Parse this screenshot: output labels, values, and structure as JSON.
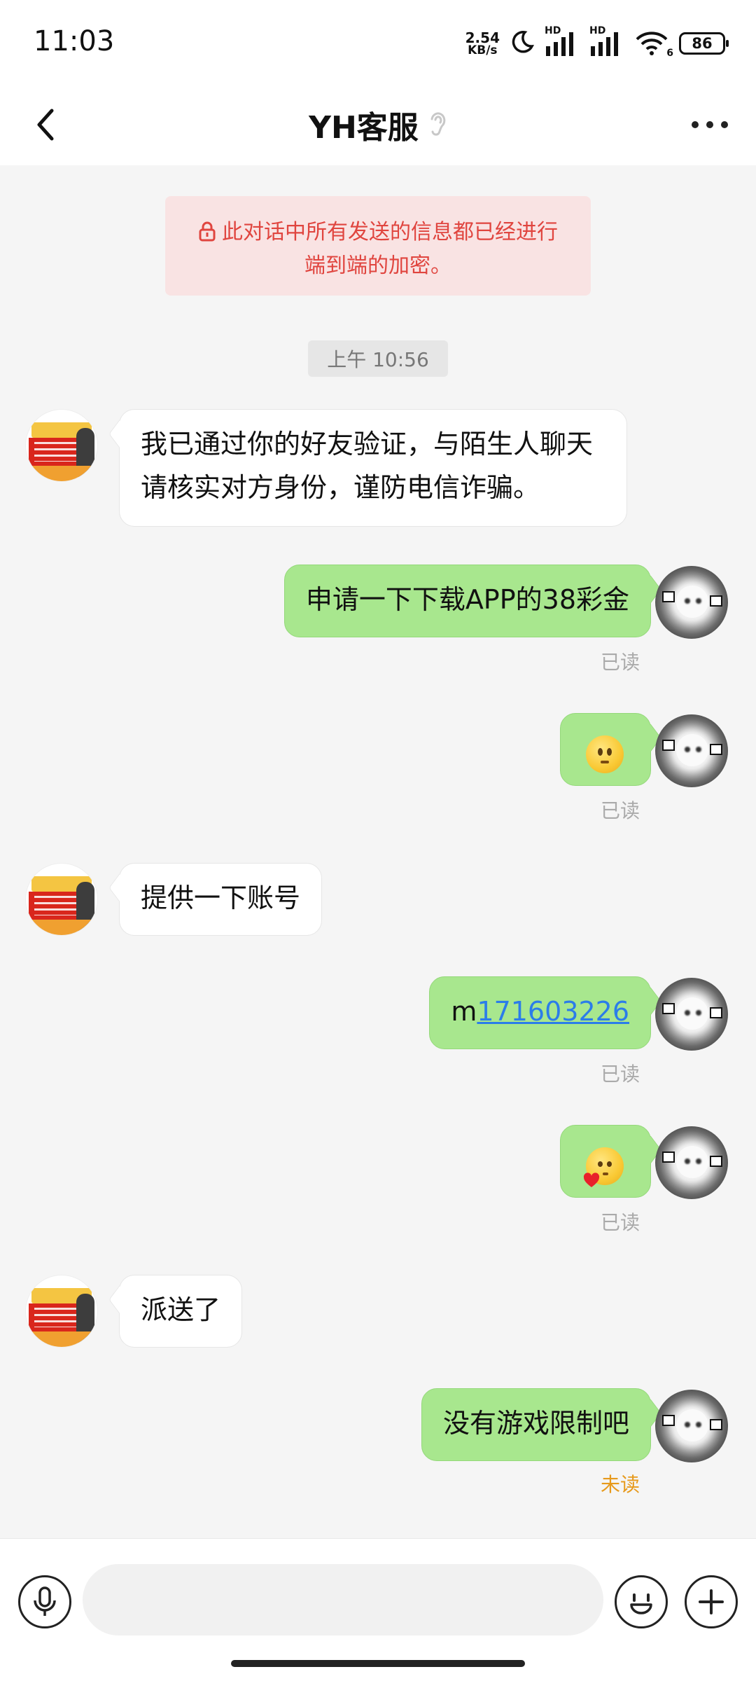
{
  "status_bar": {
    "time": "11:03",
    "net_speed_value": "2.54",
    "net_speed_unit": "KB/s",
    "sim1_label": "HD",
    "sim2_label": "HD",
    "wifi_sub": "6",
    "battery": "86"
  },
  "header": {
    "title": "YH客服"
  },
  "chat": {
    "encryption_notice": "此对话中所有发送的信息都已经进行端到端的加密。",
    "time_separator": "上午 10:56",
    "messages": [
      {
        "side": "left",
        "text": "我已通过你的好友验证，与陌生人聊天请核实对方身份，谨防电信诈骗。"
      },
      {
        "side": "right",
        "text": "申请一下下载APP的38彩金",
        "status": "已读"
      },
      {
        "side": "right",
        "emoji": "smile-emoji",
        "status": "已读"
      },
      {
        "side": "left",
        "text": "提供一下账号"
      },
      {
        "side": "right",
        "prefix": "m",
        "link": "171603226",
        "status": "已读"
      },
      {
        "side": "right",
        "emoji": "heart-kiss-emoji",
        "status": "已读"
      },
      {
        "side": "left",
        "text": "派送了"
      },
      {
        "side": "right",
        "text": "没有游戏限制吧",
        "status": "未读"
      }
    ]
  },
  "input_bar": {
    "placeholder": ""
  },
  "colors": {
    "bubble_right": "#a8e78e",
    "bubble_left": "#ffffff",
    "notice_bg": "#f9e3e3",
    "notice_text": "#e0453f",
    "link": "#2b7de9",
    "unread": "#e79a1c",
    "read": "#aaaaaa"
  }
}
